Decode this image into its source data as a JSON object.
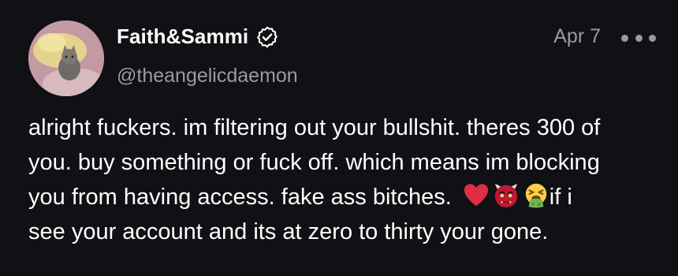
{
  "post": {
    "display_name": "Faith&Sammi",
    "handle": "@theangelicdaemon",
    "date": "Apr 7",
    "body_lines": [
      "alright fuckers. im filtering out your bullshit. theres 300 of",
      "you. buy something or fuck off. which means im blocking",
      "you from having access. fake ass bitches.",
      "see your account and its at zero to thirty your gone."
    ],
    "line3_tail": "if i",
    "emojis": [
      "red-heart-icon",
      "ogre-mask-icon",
      "vomiting-face-icon"
    ]
  },
  "icons": {
    "verified": "verified-badge-icon",
    "more": "more-options-icon"
  },
  "colors": {
    "background": "#111014",
    "text": "#ffffff",
    "secondary_text": "#9a9aa2"
  }
}
